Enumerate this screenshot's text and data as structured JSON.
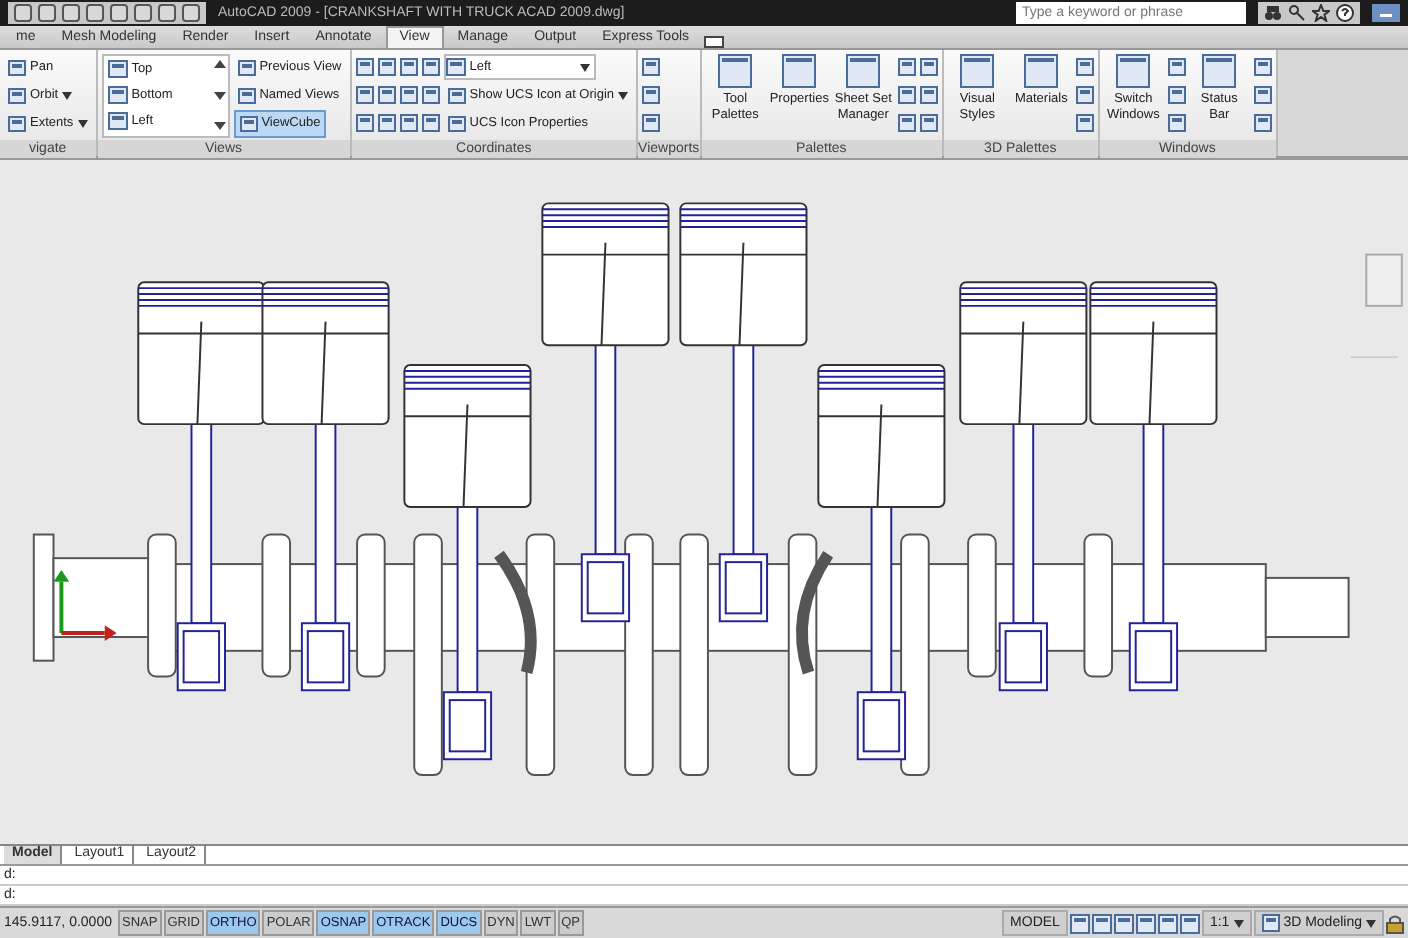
{
  "window": {
    "title": "AutoCAD 2009 - [CRANKSHAFT WITH TRUCK ACAD 2009.dwg]"
  },
  "search": {
    "placeholder": "Type a keyword or phrase"
  },
  "ribbon": {
    "tabs": [
      {
        "label": "me",
        "selected": false
      },
      {
        "label": "Mesh Modeling",
        "selected": false
      },
      {
        "label": "Render",
        "selected": false
      },
      {
        "label": "Insert",
        "selected": false
      },
      {
        "label": "Annotate",
        "selected": false
      },
      {
        "label": "View",
        "selected": true
      },
      {
        "label": "Manage",
        "selected": false
      },
      {
        "label": "Output",
        "selected": false
      },
      {
        "label": "Express Tools",
        "selected": false
      }
    ],
    "panels": [
      {
        "title": "vigate",
        "items": [
          {
            "kind": "small",
            "label": "Pan",
            "menu": false,
            "selected": false
          },
          {
            "kind": "small",
            "label": "Orbit",
            "menu": true,
            "selected": false
          },
          {
            "kind": "small",
            "label": "Extents",
            "menu": true,
            "selected": false
          }
        ]
      },
      {
        "title": "Views",
        "items": [
          {
            "kind": "list",
            "entries": [
              "Top",
              "Bottom",
              "Left"
            ]
          },
          {
            "kind": "small",
            "label": "Previous View",
            "menu": false,
            "selected": false
          },
          {
            "kind": "small",
            "label": "Named Views",
            "menu": false,
            "selected": false
          },
          {
            "kind": "small",
            "label": "ViewCube",
            "menu": false,
            "selected": true
          }
        ]
      },
      {
        "title": "Coordinates",
        "items": [
          {
            "kind": "icon"
          },
          {
            "kind": "icon"
          },
          {
            "kind": "icon"
          },
          {
            "kind": "icon"
          },
          {
            "kind": "icon"
          },
          {
            "kind": "icon"
          },
          {
            "kind": "icon"
          },
          {
            "kind": "icon"
          },
          {
            "kind": "icon"
          },
          {
            "kind": "icon"
          },
          {
            "kind": "icon"
          },
          {
            "kind": "icon"
          },
          {
            "kind": "select",
            "label": "Left"
          },
          {
            "kind": "small",
            "label": "Show UCS Icon at Origin",
            "menu": true,
            "selected": false
          },
          {
            "kind": "small",
            "label": "UCS Icon Properties",
            "menu": false,
            "selected": false
          }
        ]
      },
      {
        "title": "Viewports",
        "items": [
          {
            "kind": "icon"
          },
          {
            "kind": "icon"
          },
          {
            "kind": "icon"
          }
        ]
      },
      {
        "title": "Palettes",
        "items": [
          {
            "kind": "large",
            "label": "Tool Palettes"
          },
          {
            "kind": "large",
            "label": "Properties"
          },
          {
            "kind": "large",
            "label": "Sheet Set Manager"
          },
          {
            "kind": "icon"
          },
          {
            "kind": "icon"
          },
          {
            "kind": "icon"
          },
          {
            "kind": "icon"
          },
          {
            "kind": "icon"
          },
          {
            "kind": "icon"
          }
        ]
      },
      {
        "title": "3D Palettes",
        "items": [
          {
            "kind": "large",
            "label": "Visual Styles"
          },
          {
            "kind": "large",
            "label": "Materials"
          },
          {
            "kind": "icon"
          },
          {
            "kind": "icon"
          },
          {
            "kind": "icon"
          }
        ]
      },
      {
        "title": "Windows",
        "items": [
          {
            "kind": "large",
            "label": "Switch Windows"
          },
          {
            "kind": "icon"
          },
          {
            "kind": "icon"
          },
          {
            "kind": "icon"
          },
          {
            "kind": "large",
            "label": "Status Bar"
          },
          {
            "kind": "icon"
          },
          {
            "kind": "icon"
          },
          {
            "kind": "icon"
          }
        ]
      }
    ]
  },
  "layout_tabs": [
    {
      "label": "Model",
      "selected": true
    },
    {
      "label": "Layout1",
      "selected": false
    },
    {
      "label": "Layout2",
      "selected": false
    }
  ],
  "command_lines": [
    "d:",
    "d:"
  ],
  "status_bar": {
    "coordinates": "145.9117, 0.0000",
    "toggles": [
      {
        "label": "SNAP",
        "on": false
      },
      {
        "label": "GRID",
        "on": false
      },
      {
        "label": "ORTHO",
        "on": true
      },
      {
        "label": "POLAR",
        "on": false
      },
      {
        "label": "OSNAP",
        "on": true
      },
      {
        "label": "OTRACK",
        "on": true
      },
      {
        "label": "DUCS",
        "on": true
      },
      {
        "label": "DYN",
        "on": false
      },
      {
        "label": "LWT",
        "on": false
      },
      {
        "label": "QP",
        "on": false
      }
    ],
    "space": "MODEL",
    "scale": "1:1",
    "workspace": "3D Modeling"
  }
}
